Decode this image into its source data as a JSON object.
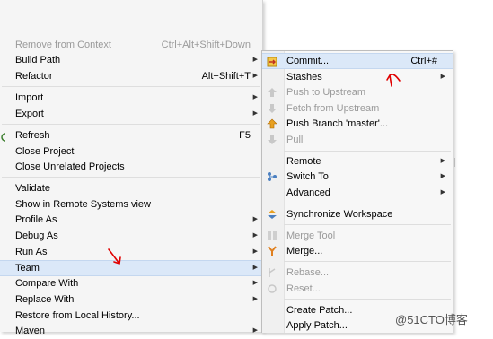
{
  "main_menu": {
    "items": [
      {
        "label": "Remove from Context",
        "accel": "Ctrl+Alt+Shift+Down",
        "disabled": true
      },
      {
        "label": "Build Path"
      },
      {
        "label": "Refactor",
        "accel": "Alt+Shift+T"
      },
      {
        "label": "Import"
      },
      {
        "label": "Export"
      },
      {
        "label": "Refresh",
        "accel": "F5"
      },
      {
        "label": "Close Project"
      },
      {
        "label": "Close Unrelated Projects"
      },
      {
        "label": "Validate"
      },
      {
        "label": "Show in Remote Systems view"
      },
      {
        "label": "Profile As"
      },
      {
        "label": "Debug As"
      },
      {
        "label": "Run As"
      },
      {
        "label": "Team"
      },
      {
        "label": "Compare With"
      },
      {
        "label": "Replace With"
      },
      {
        "label": "Restore from Local History..."
      },
      {
        "label": "Maven"
      }
    ]
  },
  "team_menu": {
    "items": [
      {
        "label": "Commit...",
        "accel": "Ctrl+#",
        "icon": "commit-icon"
      },
      {
        "label": "Stashes"
      },
      {
        "label": "Push to Upstream",
        "disabled": true,
        "icon": "push-upstream-icon"
      },
      {
        "label": "Fetch from Upstream",
        "disabled": true,
        "icon": "fetch-upstream-icon"
      },
      {
        "label": "Push Branch 'master'...",
        "icon": "push-branch-icon"
      },
      {
        "label": "Pull",
        "disabled": true,
        "icon": "pull-icon"
      },
      {
        "label": "Remote"
      },
      {
        "label": "Switch To",
        "icon": "switch-branch-icon"
      },
      {
        "label": "Advanced"
      },
      {
        "label": "Synchronize Workspace",
        "icon": "synchronize-icon"
      },
      {
        "label": "Merge Tool",
        "disabled": true,
        "icon": "merge-tool-icon"
      },
      {
        "label": "Merge...",
        "icon": "merge-icon"
      },
      {
        "label": "Rebase...",
        "disabled": true,
        "icon": "rebase-icon"
      },
      {
        "label": "Reset...",
        "disabled": true,
        "icon": "reset-icon"
      },
      {
        "label": "Create Patch..."
      },
      {
        "label": "Apply Patch..."
      }
    ]
  },
  "arrow_glyph": "▶",
  "watermark": "@51CTO博客",
  "colors": {
    "highlight": "#dbe8f8",
    "annotation": "#e00000"
  }
}
